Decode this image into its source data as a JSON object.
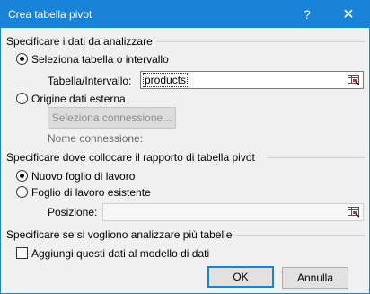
{
  "window": {
    "title": "Crea tabella pivot",
    "help_glyph": "?",
    "close_glyph": "✕"
  },
  "section1": {
    "heading": "Specificare i dati da analizzare",
    "option_table": "Seleziona tabella o intervallo",
    "table_range_label": "Tabella/Intervallo:",
    "table_range_value": "products",
    "option_external": "Origine dati esterna",
    "select_connection_button": "Seleziona connessione...",
    "connection_name_label": "Nome connessione:"
  },
  "section2": {
    "heading": "Specificare dove collocare il rapporto di tabella pivot",
    "option_new_sheet": "Nuovo foglio di lavoro",
    "option_existing_sheet": "Foglio di lavoro esistente",
    "position_label": "Posizione:",
    "position_value": ""
  },
  "section3": {
    "heading": "Specificare se si vogliono analizzare più tabelle",
    "add_to_model_label": "Aggiungi questi dati al modello di dati",
    "add_to_model_checked": false
  },
  "buttons": {
    "ok": "OK",
    "cancel": "Annulla"
  },
  "icons": {
    "range_picker": "range-selector-icon"
  },
  "colors": {
    "accent": "#1883d7",
    "dialog_bg": "#f0f0f0"
  }
}
